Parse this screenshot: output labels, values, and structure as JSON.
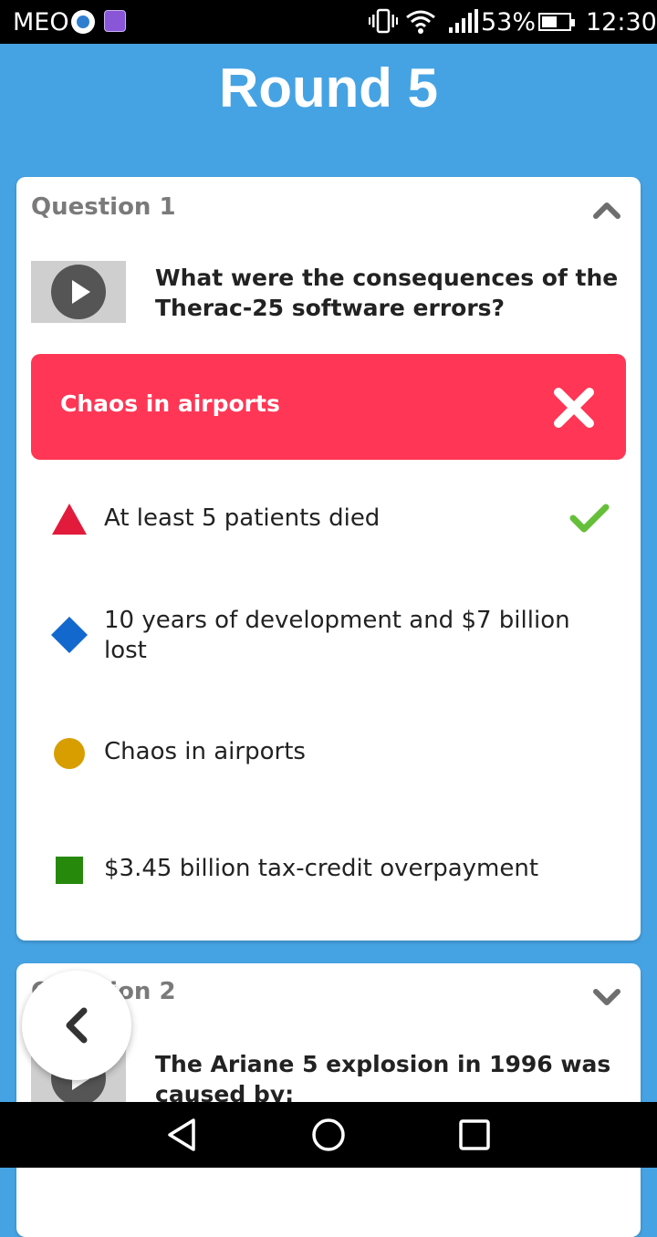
{
  "status_bar": {
    "carrier": "MEO",
    "battery": "53%",
    "time": "12:30"
  },
  "header": {
    "title": "Round 5"
  },
  "questions": [
    {
      "label": "Question 1",
      "text": "What were the consequences of the Therac-25 software errors?",
      "expanded": true,
      "selected_answer": "Chaos in airports",
      "selected_correct": false,
      "answers": [
        {
          "shape": "triangle",
          "color": "#e21b3c",
          "text": "At least 5 patients died",
          "correct": true
        },
        {
          "shape": "diamond",
          "color": "#1368ce",
          "text": "10 years of development and $7 billion lost",
          "correct": false
        },
        {
          "shape": "circle",
          "color": "#d89e00",
          "text": "Chaos in airports",
          "correct": false
        },
        {
          "shape": "square",
          "color": "#26890c",
          "text": "$3.45 billion tax-credit overpayment",
          "correct": false
        }
      ]
    },
    {
      "label": "Question 2",
      "text": "The Ariane 5 explosion in 1996 was caused by:",
      "expanded": false
    }
  ],
  "colors": {
    "background": "#46a3e3",
    "wrong": "#ff3655",
    "correct": "#66bf39"
  },
  "icons": {
    "expand": "chevron-up-icon",
    "collapse": "chevron-down-icon",
    "back": "chevron-left-icon",
    "video": "play-icon"
  }
}
